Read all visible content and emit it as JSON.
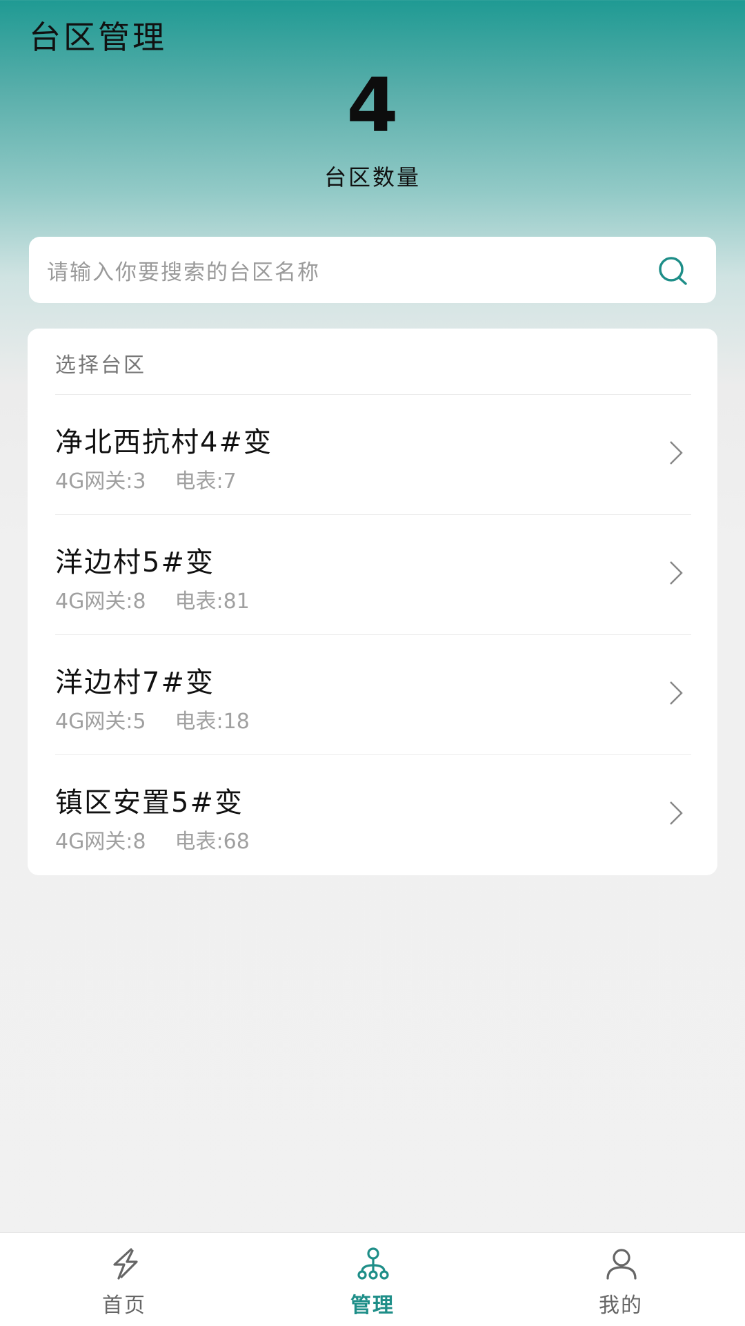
{
  "header": {
    "title": "台区管理",
    "count": "4",
    "count_label": "台区数量"
  },
  "search": {
    "placeholder": "请输入你要搜索的台区名称",
    "icon": "search-icon"
  },
  "list": {
    "heading": "选择台区",
    "items": [
      {
        "name": "净北西抗村4#变",
        "gateway": "4G网关:3",
        "meter": "电表:7"
      },
      {
        "name": "洋边村5#变",
        "gateway": "4G网关:8",
        "meter": "电表:81"
      },
      {
        "name": "洋边村7#变",
        "gateway": "4G网关:5",
        "meter": "电表:18"
      },
      {
        "name": "镇区安置5#变",
        "gateway": "4G网关:8",
        "meter": "电表:68"
      }
    ]
  },
  "tabbar": {
    "tabs": [
      {
        "label": "首页",
        "icon": "lightning-icon",
        "active": false
      },
      {
        "label": "管理",
        "icon": "hierarchy-icon",
        "active": true
      },
      {
        "label": "我的",
        "icon": "user-icon",
        "active": false
      }
    ]
  },
  "colors": {
    "accent": "#1e8e88",
    "header_gradient_top": "#1f9a93",
    "background": "#f0f0f0"
  }
}
